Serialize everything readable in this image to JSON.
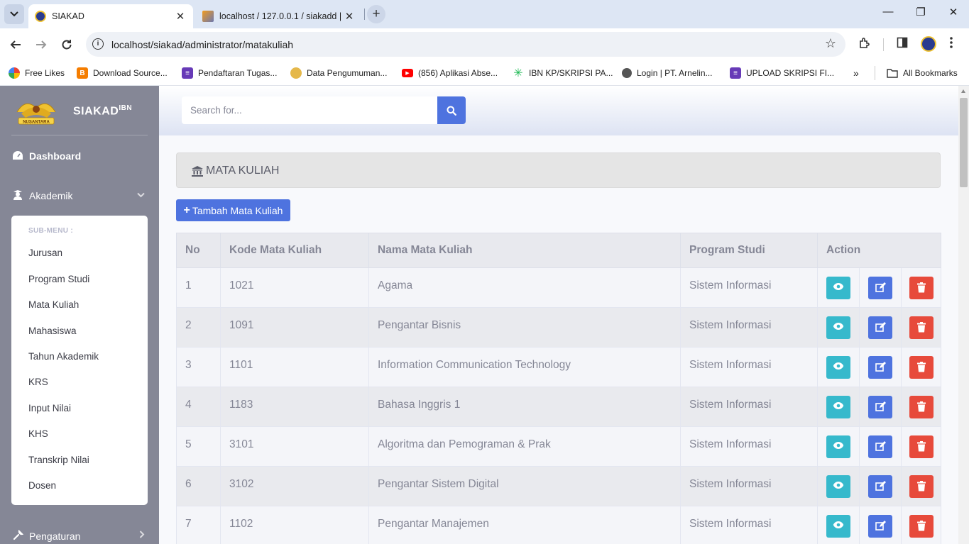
{
  "browser": {
    "tabs": [
      {
        "title": "SIAKAD",
        "active": true
      },
      {
        "title": "localhost / 127.0.0.1 / siakadd |",
        "active": false
      }
    ],
    "url": "localhost/siakad/administrator/matakuliah",
    "bookmarks": [
      {
        "label": "Free Likes",
        "icon": "google-icon"
      },
      {
        "label": "Download Source...",
        "icon": "blogger-icon"
      },
      {
        "label": "Pendaftaran Tugas...",
        "icon": "forms-icon"
      },
      {
        "label": "Data Pengumuman...",
        "icon": "emblem-icon"
      },
      {
        "label": "(856) Aplikasi Abse...",
        "icon": "youtube-icon"
      },
      {
        "label": "IBN KP/SKRIPSI PA...",
        "icon": "asterisk-icon"
      },
      {
        "label": "Login | PT. Arnelin...",
        "icon": "globe-icon"
      },
      {
        "label": "UPLOAD SKRIPSI FI...",
        "icon": "forms-icon"
      }
    ],
    "all_bookmarks": "All Bookmarks"
  },
  "sidebar": {
    "brand": "SIAKAD",
    "brand_sup": "IBN",
    "logo_text": "NUSANTARA",
    "dashboard": "Dashboard",
    "akademik": "Akademik",
    "submenu_header": "SUB-MENU :",
    "submenu": [
      "Jurusan",
      "Program Studi",
      "Mata Kuliah",
      "Mahasiswa",
      "Tahun Akademik",
      "KRS",
      "Input Nilai",
      "KHS",
      "Transkrip Nilai",
      "Dosen"
    ],
    "pengaturan": "Pengaturan"
  },
  "topbar": {
    "search_placeholder": "Search for..."
  },
  "content": {
    "title": "MATA KULIAH",
    "add_button": "Tambah Mata Kuliah",
    "table": {
      "headers": [
        "No",
        "Kode Mata Kuliah",
        "Nama Mata Kuliah",
        "Program Studi",
        "Action"
      ],
      "rows": [
        [
          "1",
          "1021",
          "Agama",
          "Sistem Informasi"
        ],
        [
          "2",
          "1091",
          "Pengantar Bisnis",
          "Sistem Informasi"
        ],
        [
          "3",
          "1101",
          "Information Communication Technology",
          "Sistem Informasi"
        ],
        [
          "4",
          "1183",
          "Bahasa Inggris 1",
          "Sistem Informasi"
        ],
        [
          "5",
          "3101",
          "Algoritma dan Pemograman & Prak",
          "Sistem Informasi"
        ],
        [
          "6",
          "3102",
          "Pengantar Sistem Digital",
          "Sistem Informasi"
        ],
        [
          "7",
          "1102",
          "Pengantar Manajemen",
          "Sistem Informasi"
        ]
      ]
    }
  },
  "colors": {
    "primary": "#4e73df",
    "info": "#36b9cc",
    "danger": "#e74a3b",
    "sidebar": "#858796"
  }
}
